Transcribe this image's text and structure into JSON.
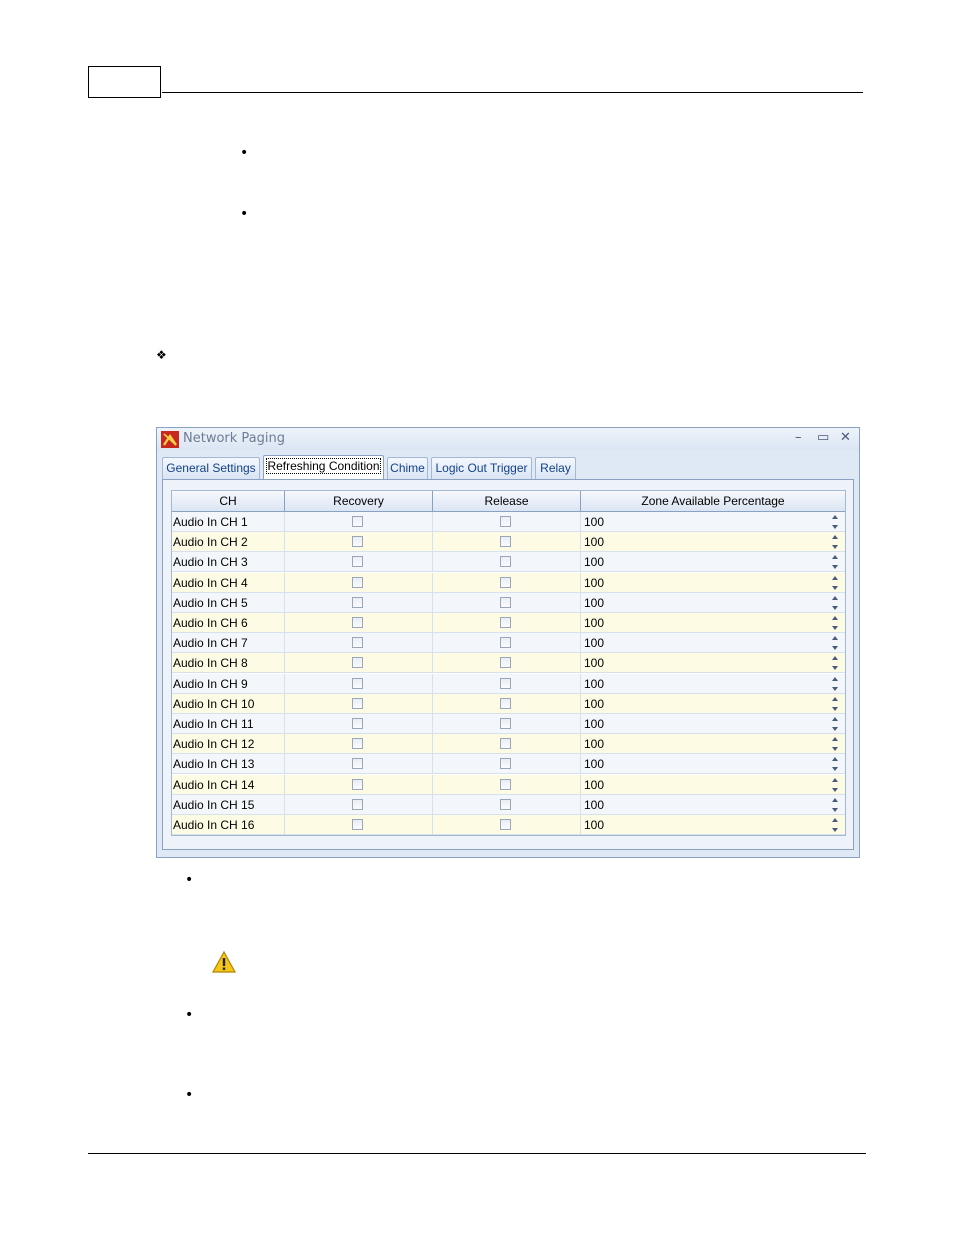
{
  "window": {
    "title": "Network Paging",
    "icon": "app-logo-icon",
    "controls": {
      "minimize": "–",
      "maximize": "▭",
      "close": "✕"
    }
  },
  "tabs": [
    {
      "label": "General Settings",
      "active": false
    },
    {
      "label": "Refreshing Condition",
      "active": true
    },
    {
      "label": "Chime",
      "active": false
    },
    {
      "label": "Logic Out Trigger",
      "active": false
    },
    {
      "label": "Relay",
      "active": false
    }
  ],
  "grid": {
    "columns": [
      "CH",
      "Recovery",
      "Release",
      "Zone Available Percentage"
    ],
    "rows": [
      {
        "ch": "Audio In CH 1",
        "recovery": false,
        "release": false,
        "zone": "100"
      },
      {
        "ch": "Audio In CH 2",
        "recovery": false,
        "release": false,
        "zone": "100"
      },
      {
        "ch": "Audio In CH 3",
        "recovery": false,
        "release": false,
        "zone": "100"
      },
      {
        "ch": "Audio In CH 4",
        "recovery": false,
        "release": false,
        "zone": "100"
      },
      {
        "ch": "Audio In CH 5",
        "recovery": false,
        "release": false,
        "zone": "100"
      },
      {
        "ch": "Audio In CH 6",
        "recovery": false,
        "release": false,
        "zone": "100"
      },
      {
        "ch": "Audio In CH 7",
        "recovery": false,
        "release": false,
        "zone": "100"
      },
      {
        "ch": "Audio In CH 8",
        "recovery": false,
        "release": false,
        "zone": "100"
      },
      {
        "ch": "Audio In CH 9",
        "recovery": false,
        "release": false,
        "zone": "100"
      },
      {
        "ch": "Audio In CH 10",
        "recovery": false,
        "release": false,
        "zone": "100"
      },
      {
        "ch": "Audio In CH 11",
        "recovery": false,
        "release": false,
        "zone": "100"
      },
      {
        "ch": "Audio In CH 12",
        "recovery": false,
        "release": false,
        "zone": "100"
      },
      {
        "ch": "Audio In CH 13",
        "recovery": false,
        "release": false,
        "zone": "100"
      },
      {
        "ch": "Audio In CH 14",
        "recovery": false,
        "release": false,
        "zone": "100"
      },
      {
        "ch": "Audio In CH 15",
        "recovery": false,
        "release": false,
        "zone": "100"
      },
      {
        "ch": "Audio In CH 16",
        "recovery": false,
        "release": false,
        "zone": "100"
      }
    ]
  },
  "page": {
    "bullet_char": "•",
    "diamond_char": "❖",
    "warning_icon": "warning-icon"
  }
}
